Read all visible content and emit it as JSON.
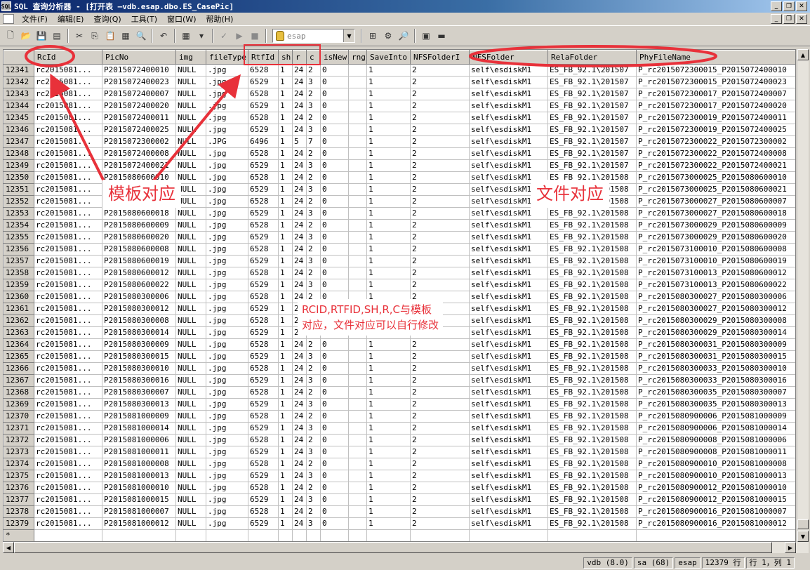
{
  "window": {
    "title": "SQL 查询分析器 - [打开表 —vdb.esap.dbo.ES_CasePic]",
    "app_icon_label": "SQL"
  },
  "menu": [
    "文件(F)",
    "编辑(E)",
    "查询(Q)",
    "工具(T)",
    "窗口(W)",
    "帮助(H)"
  ],
  "toolbar": {
    "database": "esap"
  },
  "grid": {
    "columns": [
      "RcId",
      "PicNo",
      "img",
      "fileType",
      "RtfId",
      "sh",
      "r",
      "c",
      "isNew",
      "rng",
      "SaveInto",
      "NFSFolderI",
      "NFSFolder",
      "RelaFolder",
      "PhyFileName"
    ],
    "rows": [
      {
        "n": "12341",
        "RcId": "rc2015081...",
        "PicNo": "P2015072400010",
        "img": "NULL",
        "fileType": ".jpg",
        "RtfId": "6528",
        "sh": "1",
        "r": "24",
        "c": "2",
        "isNew": "0",
        "rng": "",
        "SaveInto": "1",
        "NFSFolderI": "2",
        "NFSFolder": "self\\esdiskM1",
        "RelaFolder": "ES_FB_92.1\\201507",
        "PhyFileName": "P_rc2015072300015_P2015072400010"
      },
      {
        "n": "12342",
        "RcId": "rc2015081...",
        "PicNo": "P2015072400023",
        "img": "NULL",
        "fileType": ".jpg",
        "RtfId": "6529",
        "sh": "1",
        "r": "24",
        "c": "3",
        "isNew": "0",
        "rng": "",
        "SaveInto": "1",
        "NFSFolderI": "2",
        "NFSFolder": "self\\esdiskM1",
        "RelaFolder": "ES_FB_92.1\\201507",
        "PhyFileName": "P_rc2015072300015_P2015072400023"
      },
      {
        "n": "12343",
        "RcId": "rc2015081...",
        "PicNo": "P2015072400007",
        "img": "NULL",
        "fileType": ".jpg",
        "RtfId": "6528",
        "sh": "1",
        "r": "24",
        "c": "2",
        "isNew": "0",
        "rng": "",
        "SaveInto": "1",
        "NFSFolderI": "2",
        "NFSFolder": "self\\esdiskM1",
        "RelaFolder": "ES_FB_92.1\\201507",
        "PhyFileName": "P_rc2015072300017_P2015072400007"
      },
      {
        "n": "12344",
        "RcId": "rc2015081...",
        "PicNo": "P2015072400020",
        "img": "NULL",
        "fileType": ".jpg",
        "RtfId": "6529",
        "sh": "1",
        "r": "24",
        "c": "3",
        "isNew": "0",
        "rng": "",
        "SaveInto": "1",
        "NFSFolderI": "2",
        "NFSFolder": "self\\esdiskM1",
        "RelaFolder": "ES_FB_92.1\\201507",
        "PhyFileName": "P_rc2015072300017_P2015072400020"
      },
      {
        "n": "12345",
        "RcId": "rc2015081...",
        "PicNo": "P2015072400011",
        "img": "NULL",
        "fileType": ".jpg",
        "RtfId": "6528",
        "sh": "1",
        "r": "24",
        "c": "2",
        "isNew": "0",
        "rng": "",
        "SaveInto": "1",
        "NFSFolderI": "2",
        "NFSFolder": "self\\esdiskM1",
        "RelaFolder": "ES_FB_92.1\\201507",
        "PhyFileName": "P_rc2015072300019_P2015072400011"
      },
      {
        "n": "12346",
        "RcId": "rc2015081...",
        "PicNo": "P2015072400025",
        "img": "NULL",
        "fileType": ".jpg",
        "RtfId": "6529",
        "sh": "1",
        "r": "24",
        "c": "3",
        "isNew": "0",
        "rng": "",
        "SaveInto": "1",
        "NFSFolderI": "2",
        "NFSFolder": "self\\esdiskM1",
        "RelaFolder": "ES_FB_92.1\\201507",
        "PhyFileName": "P_rc2015072300019_P2015072400025"
      },
      {
        "n": "12347",
        "RcId": "rc2015081...",
        "PicNo": "P2015072300002",
        "img": "NULL",
        "fileType": ".JPG",
        "RtfId": "6496",
        "sh": "1",
        "r": "5",
        "c": "7",
        "isNew": "0",
        "rng": "",
        "SaveInto": "1",
        "NFSFolderI": "2",
        "NFSFolder": "self\\esdiskM1",
        "RelaFolder": "ES_FB_92.1\\201507",
        "PhyFileName": "P_rc2015072300022_P2015072300002"
      },
      {
        "n": "12348",
        "RcId": "rc2015081...",
        "PicNo": "P2015072400008",
        "img": "NULL",
        "fileType": ".jpg",
        "RtfId": "6528",
        "sh": "1",
        "r": "24",
        "c": "2",
        "isNew": "0",
        "rng": "",
        "SaveInto": "1",
        "NFSFolderI": "2",
        "NFSFolder": "self\\esdiskM1",
        "RelaFolder": "ES_FB_92.1\\201507",
        "PhyFileName": "P_rc2015072300022_P2015072400008"
      },
      {
        "n": "12349",
        "RcId": "rc2015081...",
        "PicNo": "P2015072400021",
        "img": "NULL",
        "fileType": ".jpg",
        "RtfId": "6529",
        "sh": "1",
        "r": "24",
        "c": "3",
        "isNew": "0",
        "rng": "",
        "SaveInto": "1",
        "NFSFolderI": "2",
        "NFSFolder": "self\\esdiskM1",
        "RelaFolder": "ES_FB_92.1\\201507",
        "PhyFileName": "P_rc2015072300022_P2015072400021"
      },
      {
        "n": "12350",
        "RcId": "rc2015081...",
        "PicNo": "P2015080600010",
        "img": "NULL",
        "fileType": ".jpg",
        "RtfId": "6528",
        "sh": "1",
        "r": "24",
        "c": "2",
        "isNew": "0",
        "rng": "",
        "SaveInto": "1",
        "NFSFolderI": "2",
        "NFSFolder": "self\\esdiskM1",
        "RelaFolder": "ES_FB_92.1\\201508",
        "PhyFileName": "P_rc2015073000025_P2015080600010"
      },
      {
        "n": "12351",
        "RcId": "rc2015081...",
        "PicNo": "P2015080600021",
        "img": "NULL",
        "fileType": ".jpg",
        "RtfId": "6529",
        "sh": "1",
        "r": "24",
        "c": "3",
        "isNew": "0",
        "rng": "",
        "SaveInto": "1",
        "NFSFolderI": "2",
        "NFSFolder": "self\\esdiskM1",
        "RelaFolder": "ES_FB_92.1\\201508",
        "PhyFileName": "P_rc2015073000025_P2015080600021"
      },
      {
        "n": "12352",
        "RcId": "rc2015081...",
        "PicNo": "P2015080600007",
        "img": "NULL",
        "fileType": ".jpg",
        "RtfId": "6528",
        "sh": "1",
        "r": "24",
        "c": "2",
        "isNew": "0",
        "rng": "",
        "SaveInto": "1",
        "NFSFolderI": "2",
        "NFSFolder": "self\\esdiskM1",
        "RelaFolder": "ES_FB_92.1\\201508",
        "PhyFileName": "P_rc2015073000027_P2015080600007"
      },
      {
        "n": "12353",
        "RcId": "rc2015081...",
        "PicNo": "P2015080600018",
        "img": "NULL",
        "fileType": ".jpg",
        "RtfId": "6529",
        "sh": "1",
        "r": "24",
        "c": "3",
        "isNew": "0",
        "rng": "",
        "SaveInto": "1",
        "NFSFolderI": "2",
        "NFSFolder": "self\\esdiskM1",
        "RelaFolder": "ES_FB_92.1\\201508",
        "PhyFileName": "P_rc2015073000027_P2015080600018"
      },
      {
        "n": "12354",
        "RcId": "rc2015081...",
        "PicNo": "P2015080600009",
        "img": "NULL",
        "fileType": ".jpg",
        "RtfId": "6528",
        "sh": "1",
        "r": "24",
        "c": "2",
        "isNew": "0",
        "rng": "",
        "SaveInto": "1",
        "NFSFolderI": "2",
        "NFSFolder": "self\\esdiskM1",
        "RelaFolder": "ES_FB_92.1\\201508",
        "PhyFileName": "P_rc2015073000029_P2015080600009"
      },
      {
        "n": "12355",
        "RcId": "rc2015081...",
        "PicNo": "P2015080600020",
        "img": "NULL",
        "fileType": ".jpg",
        "RtfId": "6529",
        "sh": "1",
        "r": "24",
        "c": "3",
        "isNew": "0",
        "rng": "",
        "SaveInto": "1",
        "NFSFolderI": "2",
        "NFSFolder": "self\\esdiskM1",
        "RelaFolder": "ES_FB_92.1\\201508",
        "PhyFileName": "P_rc2015073000029_P2015080600020"
      },
      {
        "n": "12356",
        "RcId": "rc2015081...",
        "PicNo": "P2015080600008",
        "img": "NULL",
        "fileType": ".jpg",
        "RtfId": "6528",
        "sh": "1",
        "r": "24",
        "c": "2",
        "isNew": "0",
        "rng": "",
        "SaveInto": "1",
        "NFSFolderI": "2",
        "NFSFolder": "self\\esdiskM1",
        "RelaFolder": "ES_FB_92.1\\201508",
        "PhyFileName": "P_rc2015073100010_P2015080600008"
      },
      {
        "n": "12357",
        "RcId": "rc2015081...",
        "PicNo": "P2015080600019",
        "img": "NULL",
        "fileType": ".jpg",
        "RtfId": "6529",
        "sh": "1",
        "r": "24",
        "c": "3",
        "isNew": "0",
        "rng": "",
        "SaveInto": "1",
        "NFSFolderI": "2",
        "NFSFolder": "self\\esdiskM1",
        "RelaFolder": "ES_FB_92.1\\201508",
        "PhyFileName": "P_rc2015073100010_P2015080600019"
      },
      {
        "n": "12358",
        "RcId": "rc2015081...",
        "PicNo": "P2015080600012",
        "img": "NULL",
        "fileType": ".jpg",
        "RtfId": "6528",
        "sh": "1",
        "r": "24",
        "c": "2",
        "isNew": "0",
        "rng": "",
        "SaveInto": "1",
        "NFSFolderI": "2",
        "NFSFolder": "self\\esdiskM1",
        "RelaFolder": "ES_FB_92.1\\201508",
        "PhyFileName": "P_rc2015073100013_P2015080600012"
      },
      {
        "n": "12359",
        "RcId": "rc2015081...",
        "PicNo": "P2015080600022",
        "img": "NULL",
        "fileType": ".jpg",
        "RtfId": "6529",
        "sh": "1",
        "r": "24",
        "c": "3",
        "isNew": "0",
        "rng": "",
        "SaveInto": "1",
        "NFSFolderI": "2",
        "NFSFolder": "self\\esdiskM1",
        "RelaFolder": "ES_FB_92.1\\201508",
        "PhyFileName": "P_rc2015073100013_P2015080600022"
      },
      {
        "n": "12360",
        "RcId": "rc2015081...",
        "PicNo": "P2015080300006",
        "img": "NULL",
        "fileType": ".jpg",
        "RtfId": "6528",
        "sh": "1",
        "r": "24",
        "c": "2",
        "isNew": "0",
        "rng": "",
        "SaveInto": "1",
        "NFSFolderI": "2",
        "NFSFolder": "self\\esdiskM1",
        "RelaFolder": "ES_FB_92.1\\201508",
        "PhyFileName": "P_rc2015080300027_P2015080300006"
      },
      {
        "n": "12361",
        "RcId": "rc2015081...",
        "PicNo": "P2015080300012",
        "img": "NULL",
        "fileType": ".jpg",
        "RtfId": "6529",
        "sh": "1",
        "r": "24",
        "c": "3",
        "isNew": "0",
        "rng": "",
        "SaveInto": "1",
        "NFSFolderI": "2",
        "NFSFolder": "self\\esdiskM1",
        "RelaFolder": "ES_FB_92.1\\201508",
        "PhyFileName": "P_rc2015080300027_P2015080300012"
      },
      {
        "n": "12362",
        "RcId": "rc2015081...",
        "PicNo": "P2015080300008",
        "img": "NULL",
        "fileType": ".jpg",
        "RtfId": "6528",
        "sh": "1",
        "r": "24",
        "c": "2",
        "isNew": "0",
        "rng": "",
        "SaveInto": "1",
        "NFSFolderI": "2",
        "NFSFolder": "self\\esdiskM1",
        "RelaFolder": "ES_FB_92.1\\201508",
        "PhyFileName": "P_rc2015080300029_P2015080300008"
      },
      {
        "n": "12363",
        "RcId": "rc2015081...",
        "PicNo": "P2015080300014",
        "img": "NULL",
        "fileType": ".jpg",
        "RtfId": "6529",
        "sh": "1",
        "r": "24",
        "c": "3",
        "isNew": "0",
        "rng": "",
        "SaveInto": "1",
        "NFSFolderI": "2",
        "NFSFolder": "self\\esdiskM1",
        "RelaFolder": "ES_FB_92.1\\201508",
        "PhyFileName": "P_rc2015080300029_P2015080300014"
      },
      {
        "n": "12364",
        "RcId": "rc2015081...",
        "PicNo": "P2015080300009",
        "img": "NULL",
        "fileType": ".jpg",
        "RtfId": "6528",
        "sh": "1",
        "r": "24",
        "c": "2",
        "isNew": "0",
        "rng": "",
        "SaveInto": "1",
        "NFSFolderI": "2",
        "NFSFolder": "self\\esdiskM1",
        "RelaFolder": "ES_FB_92.1\\201508",
        "PhyFileName": "P_rc2015080300031_P2015080300009"
      },
      {
        "n": "12365",
        "RcId": "rc2015081...",
        "PicNo": "P2015080300015",
        "img": "NULL",
        "fileType": ".jpg",
        "RtfId": "6529",
        "sh": "1",
        "r": "24",
        "c": "3",
        "isNew": "0",
        "rng": "",
        "SaveInto": "1",
        "NFSFolderI": "2",
        "NFSFolder": "self\\esdiskM1",
        "RelaFolder": "ES_FB_92.1\\201508",
        "PhyFileName": "P_rc2015080300031_P2015080300015"
      },
      {
        "n": "12366",
        "RcId": "rc2015081...",
        "PicNo": "P2015080300010",
        "img": "NULL",
        "fileType": ".jpg",
        "RtfId": "6528",
        "sh": "1",
        "r": "24",
        "c": "2",
        "isNew": "0",
        "rng": "",
        "SaveInto": "1",
        "NFSFolderI": "2",
        "NFSFolder": "self\\esdiskM1",
        "RelaFolder": "ES_FB_92.1\\201508",
        "PhyFileName": "P_rc2015080300033_P2015080300010"
      },
      {
        "n": "12367",
        "RcId": "rc2015081...",
        "PicNo": "P2015080300016",
        "img": "NULL",
        "fileType": ".jpg",
        "RtfId": "6529",
        "sh": "1",
        "r": "24",
        "c": "3",
        "isNew": "0",
        "rng": "",
        "SaveInto": "1",
        "NFSFolderI": "2",
        "NFSFolder": "self\\esdiskM1",
        "RelaFolder": "ES_FB_92.1\\201508",
        "PhyFileName": "P_rc2015080300033_P2015080300016"
      },
      {
        "n": "12368",
        "RcId": "rc2015081...",
        "PicNo": "P2015080300007",
        "img": "NULL",
        "fileType": ".jpg",
        "RtfId": "6528",
        "sh": "1",
        "r": "24",
        "c": "2",
        "isNew": "0",
        "rng": "",
        "SaveInto": "1",
        "NFSFolderI": "2",
        "NFSFolder": "self\\esdiskM1",
        "RelaFolder": "ES_FB_92.1\\201508",
        "PhyFileName": "P_rc2015080300035_P2015080300007"
      },
      {
        "n": "12369",
        "RcId": "rc2015081...",
        "PicNo": "P2015080300013",
        "img": "NULL",
        "fileType": ".jpg",
        "RtfId": "6529",
        "sh": "1",
        "r": "24",
        "c": "3",
        "isNew": "0",
        "rng": "",
        "SaveInto": "1",
        "NFSFolderI": "2",
        "NFSFolder": "self\\esdiskM1",
        "RelaFolder": "ES_FB_92.1\\201508",
        "PhyFileName": "P_rc2015080300035_P2015080300013"
      },
      {
        "n": "12370",
        "RcId": "rc2015081...",
        "PicNo": "P2015081000009",
        "img": "NULL",
        "fileType": ".jpg",
        "RtfId": "6528",
        "sh": "1",
        "r": "24",
        "c": "2",
        "isNew": "0",
        "rng": "",
        "SaveInto": "1",
        "NFSFolderI": "2",
        "NFSFolder": "self\\esdiskM1",
        "RelaFolder": "ES_FB_92.1\\201508",
        "PhyFileName": "P_rc2015080900006_P2015081000009"
      },
      {
        "n": "12371",
        "RcId": "rc2015081...",
        "PicNo": "P2015081000014",
        "img": "NULL",
        "fileType": ".jpg",
        "RtfId": "6529",
        "sh": "1",
        "r": "24",
        "c": "3",
        "isNew": "0",
        "rng": "",
        "SaveInto": "1",
        "NFSFolderI": "2",
        "NFSFolder": "self\\esdiskM1",
        "RelaFolder": "ES_FB_92.1\\201508",
        "PhyFileName": "P_rc2015080900006_P2015081000014"
      },
      {
        "n": "12372",
        "RcId": "rc2015081...",
        "PicNo": "P2015081000006",
        "img": "NULL",
        "fileType": ".jpg",
        "RtfId": "6528",
        "sh": "1",
        "r": "24",
        "c": "2",
        "isNew": "0",
        "rng": "",
        "SaveInto": "1",
        "NFSFolderI": "2",
        "NFSFolder": "self\\esdiskM1",
        "RelaFolder": "ES_FB_92.1\\201508",
        "PhyFileName": "P_rc2015080900008_P2015081000006"
      },
      {
        "n": "12373",
        "RcId": "rc2015081...",
        "PicNo": "P2015081000011",
        "img": "NULL",
        "fileType": ".jpg",
        "RtfId": "6529",
        "sh": "1",
        "r": "24",
        "c": "3",
        "isNew": "0",
        "rng": "",
        "SaveInto": "1",
        "NFSFolderI": "2",
        "NFSFolder": "self\\esdiskM1",
        "RelaFolder": "ES_FB_92.1\\201508",
        "PhyFileName": "P_rc2015080900008_P2015081000011"
      },
      {
        "n": "12374",
        "RcId": "rc2015081...",
        "PicNo": "P2015081000008",
        "img": "NULL",
        "fileType": ".jpg",
        "RtfId": "6528",
        "sh": "1",
        "r": "24",
        "c": "2",
        "isNew": "0",
        "rng": "",
        "SaveInto": "1",
        "NFSFolderI": "2",
        "NFSFolder": "self\\esdiskM1",
        "RelaFolder": "ES_FB_92.1\\201508",
        "PhyFileName": "P_rc2015080900010_P2015081000008"
      },
      {
        "n": "12375",
        "RcId": "rc2015081...",
        "PicNo": "P2015081000013",
        "img": "NULL",
        "fileType": ".jpg",
        "RtfId": "6529",
        "sh": "1",
        "r": "24",
        "c": "3",
        "isNew": "0",
        "rng": "",
        "SaveInto": "1",
        "NFSFolderI": "2",
        "NFSFolder": "self\\esdiskM1",
        "RelaFolder": "ES_FB_92.1\\201508",
        "PhyFileName": "P_rc2015080900010_P2015081000013"
      },
      {
        "n": "12376",
        "RcId": "rc2015081...",
        "PicNo": "P2015081000010",
        "img": "NULL",
        "fileType": ".jpg",
        "RtfId": "6528",
        "sh": "1",
        "r": "24",
        "c": "2",
        "isNew": "0",
        "rng": "",
        "SaveInto": "1",
        "NFSFolderI": "2",
        "NFSFolder": "self\\esdiskM1",
        "RelaFolder": "ES_FB_92.1\\201508",
        "PhyFileName": "P_rc2015080900012_P2015081000010"
      },
      {
        "n": "12377",
        "RcId": "rc2015081...",
        "PicNo": "P2015081000015",
        "img": "NULL",
        "fileType": ".jpg",
        "RtfId": "6529",
        "sh": "1",
        "r": "24",
        "c": "3",
        "isNew": "0",
        "rng": "",
        "SaveInto": "1",
        "NFSFolderI": "2",
        "NFSFolder": "self\\esdiskM1",
        "RelaFolder": "ES_FB_92.1\\201508",
        "PhyFileName": "P_rc2015080900012_P2015081000015"
      },
      {
        "n": "12378",
        "RcId": "rc2015081...",
        "PicNo": "P2015081000007",
        "img": "NULL",
        "fileType": ".jpg",
        "RtfId": "6528",
        "sh": "1",
        "r": "24",
        "c": "2",
        "isNew": "0",
        "rng": "",
        "SaveInto": "1",
        "NFSFolderI": "2",
        "NFSFolder": "self\\esdiskM1",
        "RelaFolder": "ES_FB_92.1\\201508",
        "PhyFileName": "P_rc2015080900016_P2015081000007"
      },
      {
        "n": "12379",
        "RcId": "rc2015081...",
        "PicNo": "P2015081000012",
        "img": "NULL",
        "fileType": ".jpg",
        "RtfId": "6529",
        "sh": "1",
        "r": "24",
        "c": "3",
        "isNew": "0",
        "rng": "",
        "SaveInto": "1",
        "NFSFolderI": "2",
        "NFSFolder": "self\\esdiskM1",
        "RelaFolder": "ES_FB_92.1\\201508",
        "PhyFileName": "P_rc2015080900016_P2015081000012"
      }
    ],
    "new_row_marker": "*"
  },
  "annotations": {
    "template_label": "模板对应",
    "file_label": "文件对应",
    "note_line1": "RCID,RTFID,SH,R,C与模板",
    "note_line2": "对应，文件对应可以自行修改",
    "color": "#e8313a"
  },
  "status": {
    "server": "vdb (8.0)",
    "user": "sa (68)",
    "db": "esap",
    "rows": "12379 行",
    "position": "行 1，列 1"
  }
}
